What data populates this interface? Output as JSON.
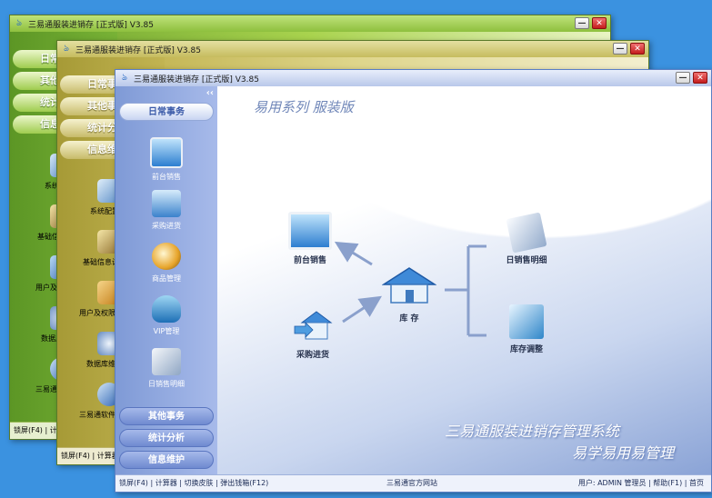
{
  "window_title": "三易通服装进销存 [正式版] V3.85",
  "back_windows": {
    "nav_buttons": [
      "日常事务",
      "其他事务",
      "统计分析",
      "信息维护"
    ],
    "w1_items": [
      "系统配",
      "基础信息",
      "用户及权",
      "数据库",
      "三易通"
    ],
    "w2_items": [
      "系统配置",
      "基础信息设",
      "用户及权限",
      "数据库维",
      "三易通软件"
    ],
    "w1_status": "锁屏(F4) | 计",
    "w2_status": "锁屏(F4) | 计算器"
  },
  "sidebar": {
    "collapse_glyph": "‹‹",
    "top_button": "日常事务",
    "items": [
      "前台销售",
      "采购进货",
      "商品管理",
      "VIP管理",
      "日销售明细"
    ],
    "bottom_buttons": [
      "其他事务",
      "统计分析",
      "信息维护"
    ]
  },
  "main": {
    "brand": "易用系列 服装版",
    "flow": {
      "front_sales": "前台销售",
      "purchase": "采购进货",
      "inventory": "库 存",
      "daily_detail": "日销售明细",
      "stock_adjust": "库存调整"
    },
    "slogan_line1": "三易通服装进销存管理系统",
    "slogan_line2": "易学易用易管理"
  },
  "statusbar": {
    "left": "锁屏(F4) | 计算器 | 切换皮肤 | 弹出钱箱(F12)",
    "center": "三易通官方网站",
    "right": "用户: ADMIN 管理员 | 帮助(F1) | 首页"
  },
  "controls": {
    "minimize": "—",
    "close": "✕"
  },
  "colors": {
    "desktop": "#3b92e0",
    "green_skin": "#8ec03e",
    "olive_skin": "#c6bc5e",
    "blue_skin": "#7f9ad6",
    "close_red": "#c41c1c"
  }
}
